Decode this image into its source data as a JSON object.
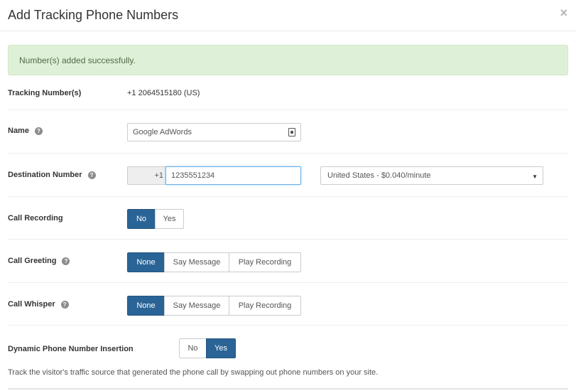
{
  "modal": {
    "title": "Add Tracking Phone Numbers",
    "close_glyph": "×"
  },
  "alert": {
    "message": "Number(s) added successfully."
  },
  "tracking": {
    "label": "Tracking Number(s)",
    "value": "+1 2064515180 (US)"
  },
  "name": {
    "label": "Name",
    "value": "Google AdWords"
  },
  "destination": {
    "label": "Destination Number",
    "prefix": "+1",
    "value": "1235551234",
    "country_rate": "United States - $0.040/minute",
    "caret": "▼"
  },
  "call_recording": {
    "label": "Call Recording",
    "options": [
      "No",
      "Yes"
    ],
    "selected": "No"
  },
  "call_greeting": {
    "label": "Call Greeting",
    "options": [
      "None",
      "Say Message",
      "Play Recording"
    ],
    "selected": "None"
  },
  "call_whisper": {
    "label": "Call Whisper",
    "options": [
      "None",
      "Say Message",
      "Play Recording"
    ],
    "selected": "None"
  },
  "dni": {
    "label": "Dynamic Phone Number Insertion",
    "options": [
      "No",
      "Yes"
    ],
    "selected": "Yes",
    "description": "Track the visitor's traffic source that generated the phone call by swapping out phone numbers on your site."
  },
  "help_glyph": "?",
  "colors": {
    "active_button": "#2a6496",
    "alert_background": "#dff0d8",
    "focus_border": "#66afe9"
  }
}
